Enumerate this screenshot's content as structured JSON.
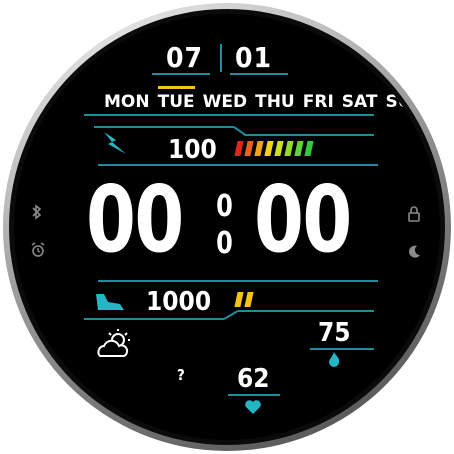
{
  "date": {
    "month": "07",
    "day": "01",
    "separator": "|"
  },
  "weekdays": [
    {
      "label": "MON",
      "active": false
    },
    {
      "label": "TUE",
      "active": true
    },
    {
      "label": "WED",
      "active": false
    },
    {
      "label": "THU",
      "active": false
    },
    {
      "label": "FRI",
      "active": false
    },
    {
      "label": "SAT",
      "active": false
    },
    {
      "label": "SUN",
      "active": false
    }
  ],
  "battery": {
    "value": "100",
    "icon": "lightning-bolt-icon",
    "level_bars": 8,
    "bar_colors": [
      "#e0261b",
      "#e8611a",
      "#f0a21b",
      "#f3d21c",
      "#c9e023",
      "#8fdc26",
      "#5fd33a",
      "#2fcc3f"
    ]
  },
  "time": {
    "hours": "00",
    "minutes": "00",
    "seconds_top": "0",
    "seconds_bottom": "0"
  },
  "steps": {
    "value": "1000",
    "icon": "shoe-icon",
    "progress_bars": 2,
    "bar_color": "#f4c21a"
  },
  "weather": {
    "icon": "partly-cloudy-icon",
    "temperature": "?"
  },
  "calories": {
    "value": "75",
    "icon": "flame-icon"
  },
  "heart_rate": {
    "value": "62",
    "icon": "heart-icon"
  },
  "left_icons": [
    "bluetooth-icon",
    "alarm-icon"
  ],
  "right_icons": [
    "lock-icon",
    "moon-icon"
  ],
  "colors": {
    "accent": "#1f8d9a",
    "highlight": "#f4c21a",
    "background": "#000000"
  }
}
